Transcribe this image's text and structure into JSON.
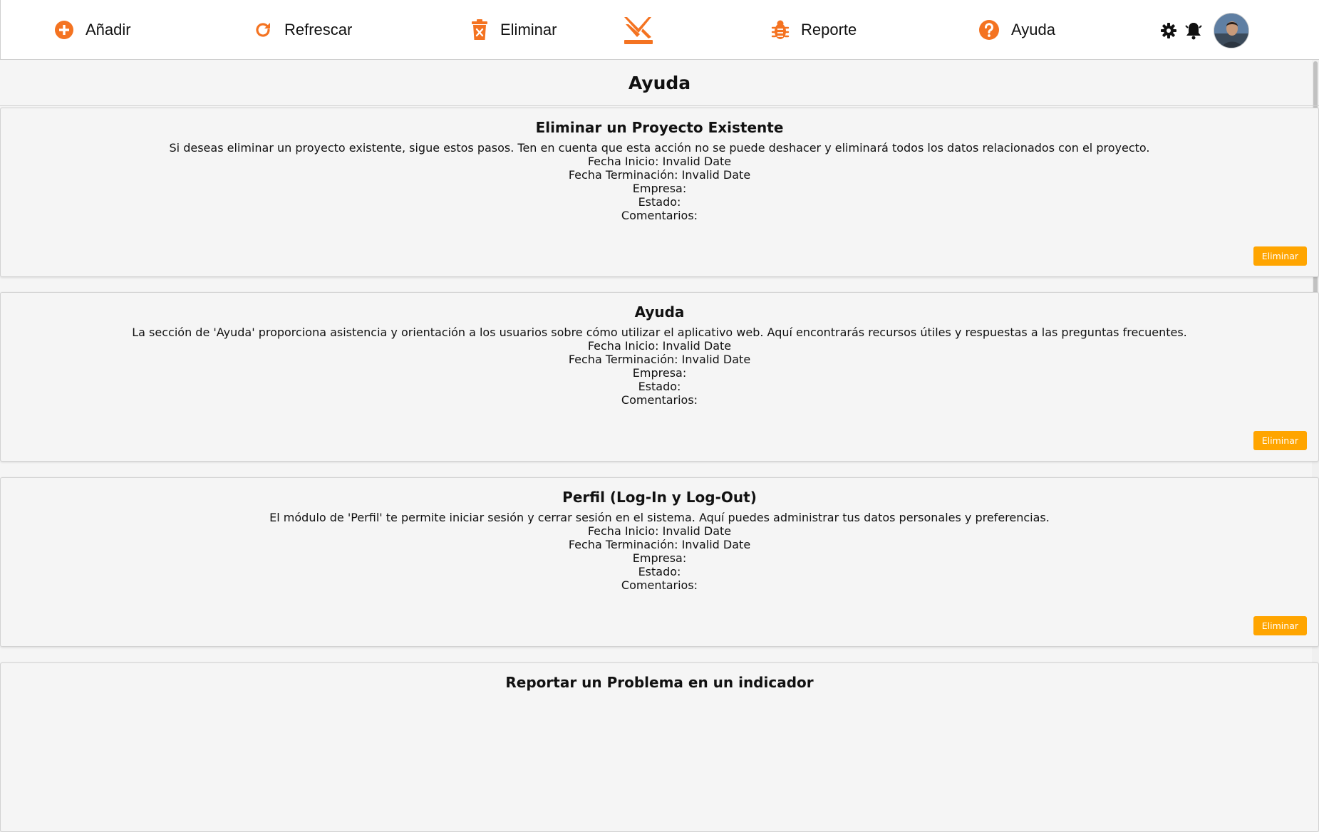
{
  "toolbar": {
    "items": [
      {
        "label": "Añadir",
        "icon": "plus-circle-icon"
      },
      {
        "label": "Refrescar",
        "icon": "refresh-icon"
      },
      {
        "label": "Eliminar",
        "icon": "trash-icon"
      },
      {
        "label": "Reporte",
        "icon": "bug-icon"
      },
      {
        "label": "Ayuda",
        "icon": "question-circle-icon"
      }
    ],
    "accent": "#f47321",
    "logo": "brand-logo-icon"
  },
  "header_right": {
    "settings_icon": "gear-icon",
    "notifications_icon": "bell-icon",
    "avatar": "user-avatar"
  },
  "page": {
    "title": "Ayuda"
  },
  "cards": [
    {
      "title": "Eliminar un Proyecto Existente",
      "description": "Si deseas eliminar un proyecto existente, sigue estos pasos. Ten en cuenta que esta acción no se puede deshacer y eliminará todos los datos relacionados con el proyecto.",
      "fecha_inicio": "Fecha Inicio: Invalid Date",
      "fecha_terminacion": "Fecha Terminación: Invalid Date",
      "empresa": "Empresa:",
      "estado": "Estado:",
      "comentarios": "Comentarios:",
      "button": "Eliminar"
    },
    {
      "title": "Ayuda",
      "description": "La sección de 'Ayuda' proporciona asistencia y orientación a los usuarios sobre cómo utilizar el aplicativo web. Aquí encontrarás recursos útiles y respuestas a las preguntas frecuentes.",
      "fecha_inicio": "Fecha Inicio: Invalid Date",
      "fecha_terminacion": "Fecha Terminación: Invalid Date",
      "empresa": "Empresa:",
      "estado": "Estado:",
      "comentarios": "Comentarios:",
      "button": "Eliminar"
    },
    {
      "title": "Perfil (Log-In y Log-Out)",
      "description": "El módulo de 'Perfil' te permite iniciar sesión y cerrar sesión en el sistema. Aquí puedes administrar tus datos personales y preferencias.",
      "fecha_inicio": "Fecha Inicio: Invalid Date",
      "fecha_terminacion": "Fecha Terminación: Invalid Date",
      "empresa": "Empresa:",
      "estado": "Estado:",
      "comentarios": "Comentarios:",
      "button": "Eliminar"
    },
    {
      "title": "Reportar un Problema en un indicador"
    }
  ],
  "colors": {
    "button_bg": "#ffa500",
    "background": "#f5f5f5"
  }
}
